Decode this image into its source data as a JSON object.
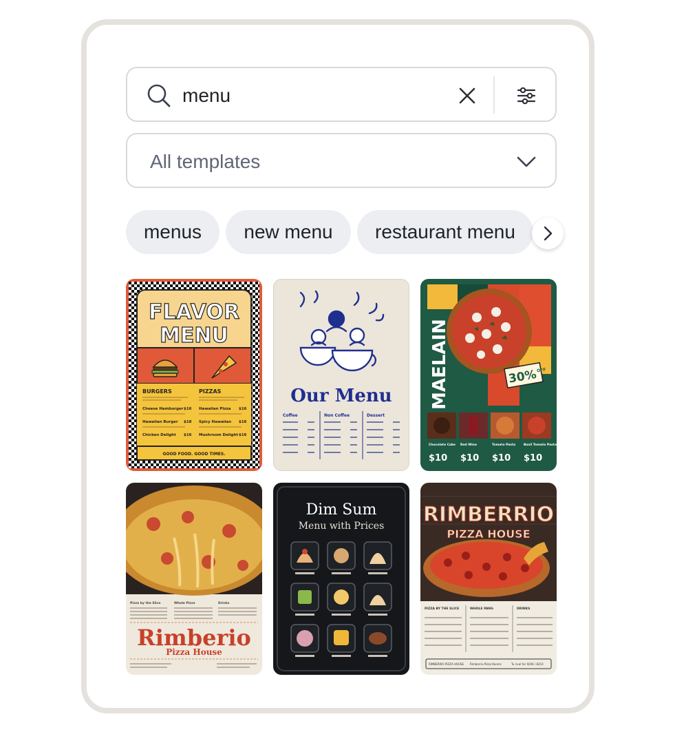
{
  "search": {
    "query": "menu",
    "icon": "search-icon",
    "clear_icon": "close-icon",
    "filter_icon": "sliders-icon"
  },
  "filter": {
    "selected": "All templates",
    "icon": "chevron-down-icon"
  },
  "chips": [
    "menus",
    "new menu",
    "restaurant menu"
  ],
  "chip_scroll_icon": "chevron-right-icon",
  "templates": [
    {
      "title_line1": "FLAVOR",
      "title_line2": "MENU",
      "left_heading": "BURGERS",
      "right_heading": "PIZZAS",
      "left_items": [
        "Cheese Hamburger",
        "Hawaiian Burger",
        "Chicken Delight"
      ],
      "left_prices": [
        "$16",
        "$18",
        "$16"
      ],
      "right_items": [
        "Hawaiian Pizza",
        "Spicy Hawaiian",
        "Mushroom Delight"
      ],
      "right_prices": [
        "$16",
        "$16",
        "$16"
      ],
      "footer": "GOOD FOOD. GOOD TIMES."
    },
    {
      "title": "Our Menu",
      "columns": [
        "Coffee",
        "Non Coffee",
        "Dessert"
      ]
    },
    {
      "brand": "MAELAIN",
      "badge_value": "30%",
      "badge_label": "OFF",
      "items": [
        "Chocolate Cake",
        "Red Wine",
        "Tomato Pasta",
        "Basil Tomato Pasta"
      ],
      "prices": [
        "$10",
        "$10",
        "$10",
        "$10"
      ]
    },
    {
      "title": "Rimberio",
      "subtitle": "Pizza House",
      "sections": [
        "Pizza by the Slice",
        "Whole Pizza",
        "Drinks"
      ]
    },
    {
      "title": "Dim Sum",
      "subtitle": "Menu with Prices"
    },
    {
      "title": "RIMBERRIO",
      "subtitle": "PIZZA HOUSE",
      "sections": [
        "PIZZA BY THE SLICE",
        "WHOLE PANG",
        "DRINKS"
      ],
      "footer": [
        "RIMBERRIO PIZZA HOUSE",
        "Rimberrio Pizza Rooms",
        "Tu rival for 9206 / 8210"
      ]
    }
  ]
}
